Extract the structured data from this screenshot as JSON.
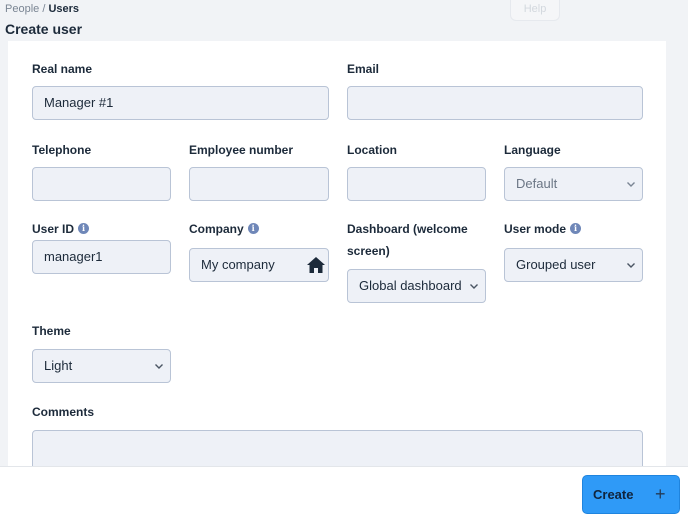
{
  "breadcrumb": {
    "parent": "People",
    "separator": " / ",
    "current": "Users"
  },
  "page_title": "Create user",
  "help_label": "Help",
  "fields": {
    "real_name": {
      "label": "Real name",
      "value": "Manager #1"
    },
    "email": {
      "label": "Email",
      "value": ""
    },
    "telephone": {
      "label": "Telephone",
      "value": ""
    },
    "employee_number": {
      "label": "Employee number",
      "value": ""
    },
    "location": {
      "label": "Location",
      "value": ""
    },
    "language": {
      "label": "Language",
      "value": "Default"
    },
    "user_id": {
      "label": "User ID",
      "value": "manager1"
    },
    "company": {
      "label": "Company",
      "value": "My company"
    },
    "dashboard": {
      "label": "Dashboard (welcome screen)",
      "label_line1": "Dashboard (welcome",
      "label_line2": "screen)",
      "value": "Global dashboard"
    },
    "user_mode": {
      "label": "User mode",
      "value": "Grouped user"
    },
    "theme": {
      "label": "Theme",
      "value": "Light"
    },
    "comments": {
      "label": "Comments",
      "value": ""
    }
  },
  "icons": {
    "info": "info-icon",
    "home": "home-icon",
    "chevron": "chevron-down-icon",
    "plus": "plus-icon"
  },
  "footer": {
    "create_label": "Create",
    "create_icon": "+"
  },
  "colors": {
    "primary_button": "#2f9af7",
    "input_bg": "#eef1f7",
    "input_border": "#b9c4d6",
    "info_icon": "#6f87b8"
  }
}
